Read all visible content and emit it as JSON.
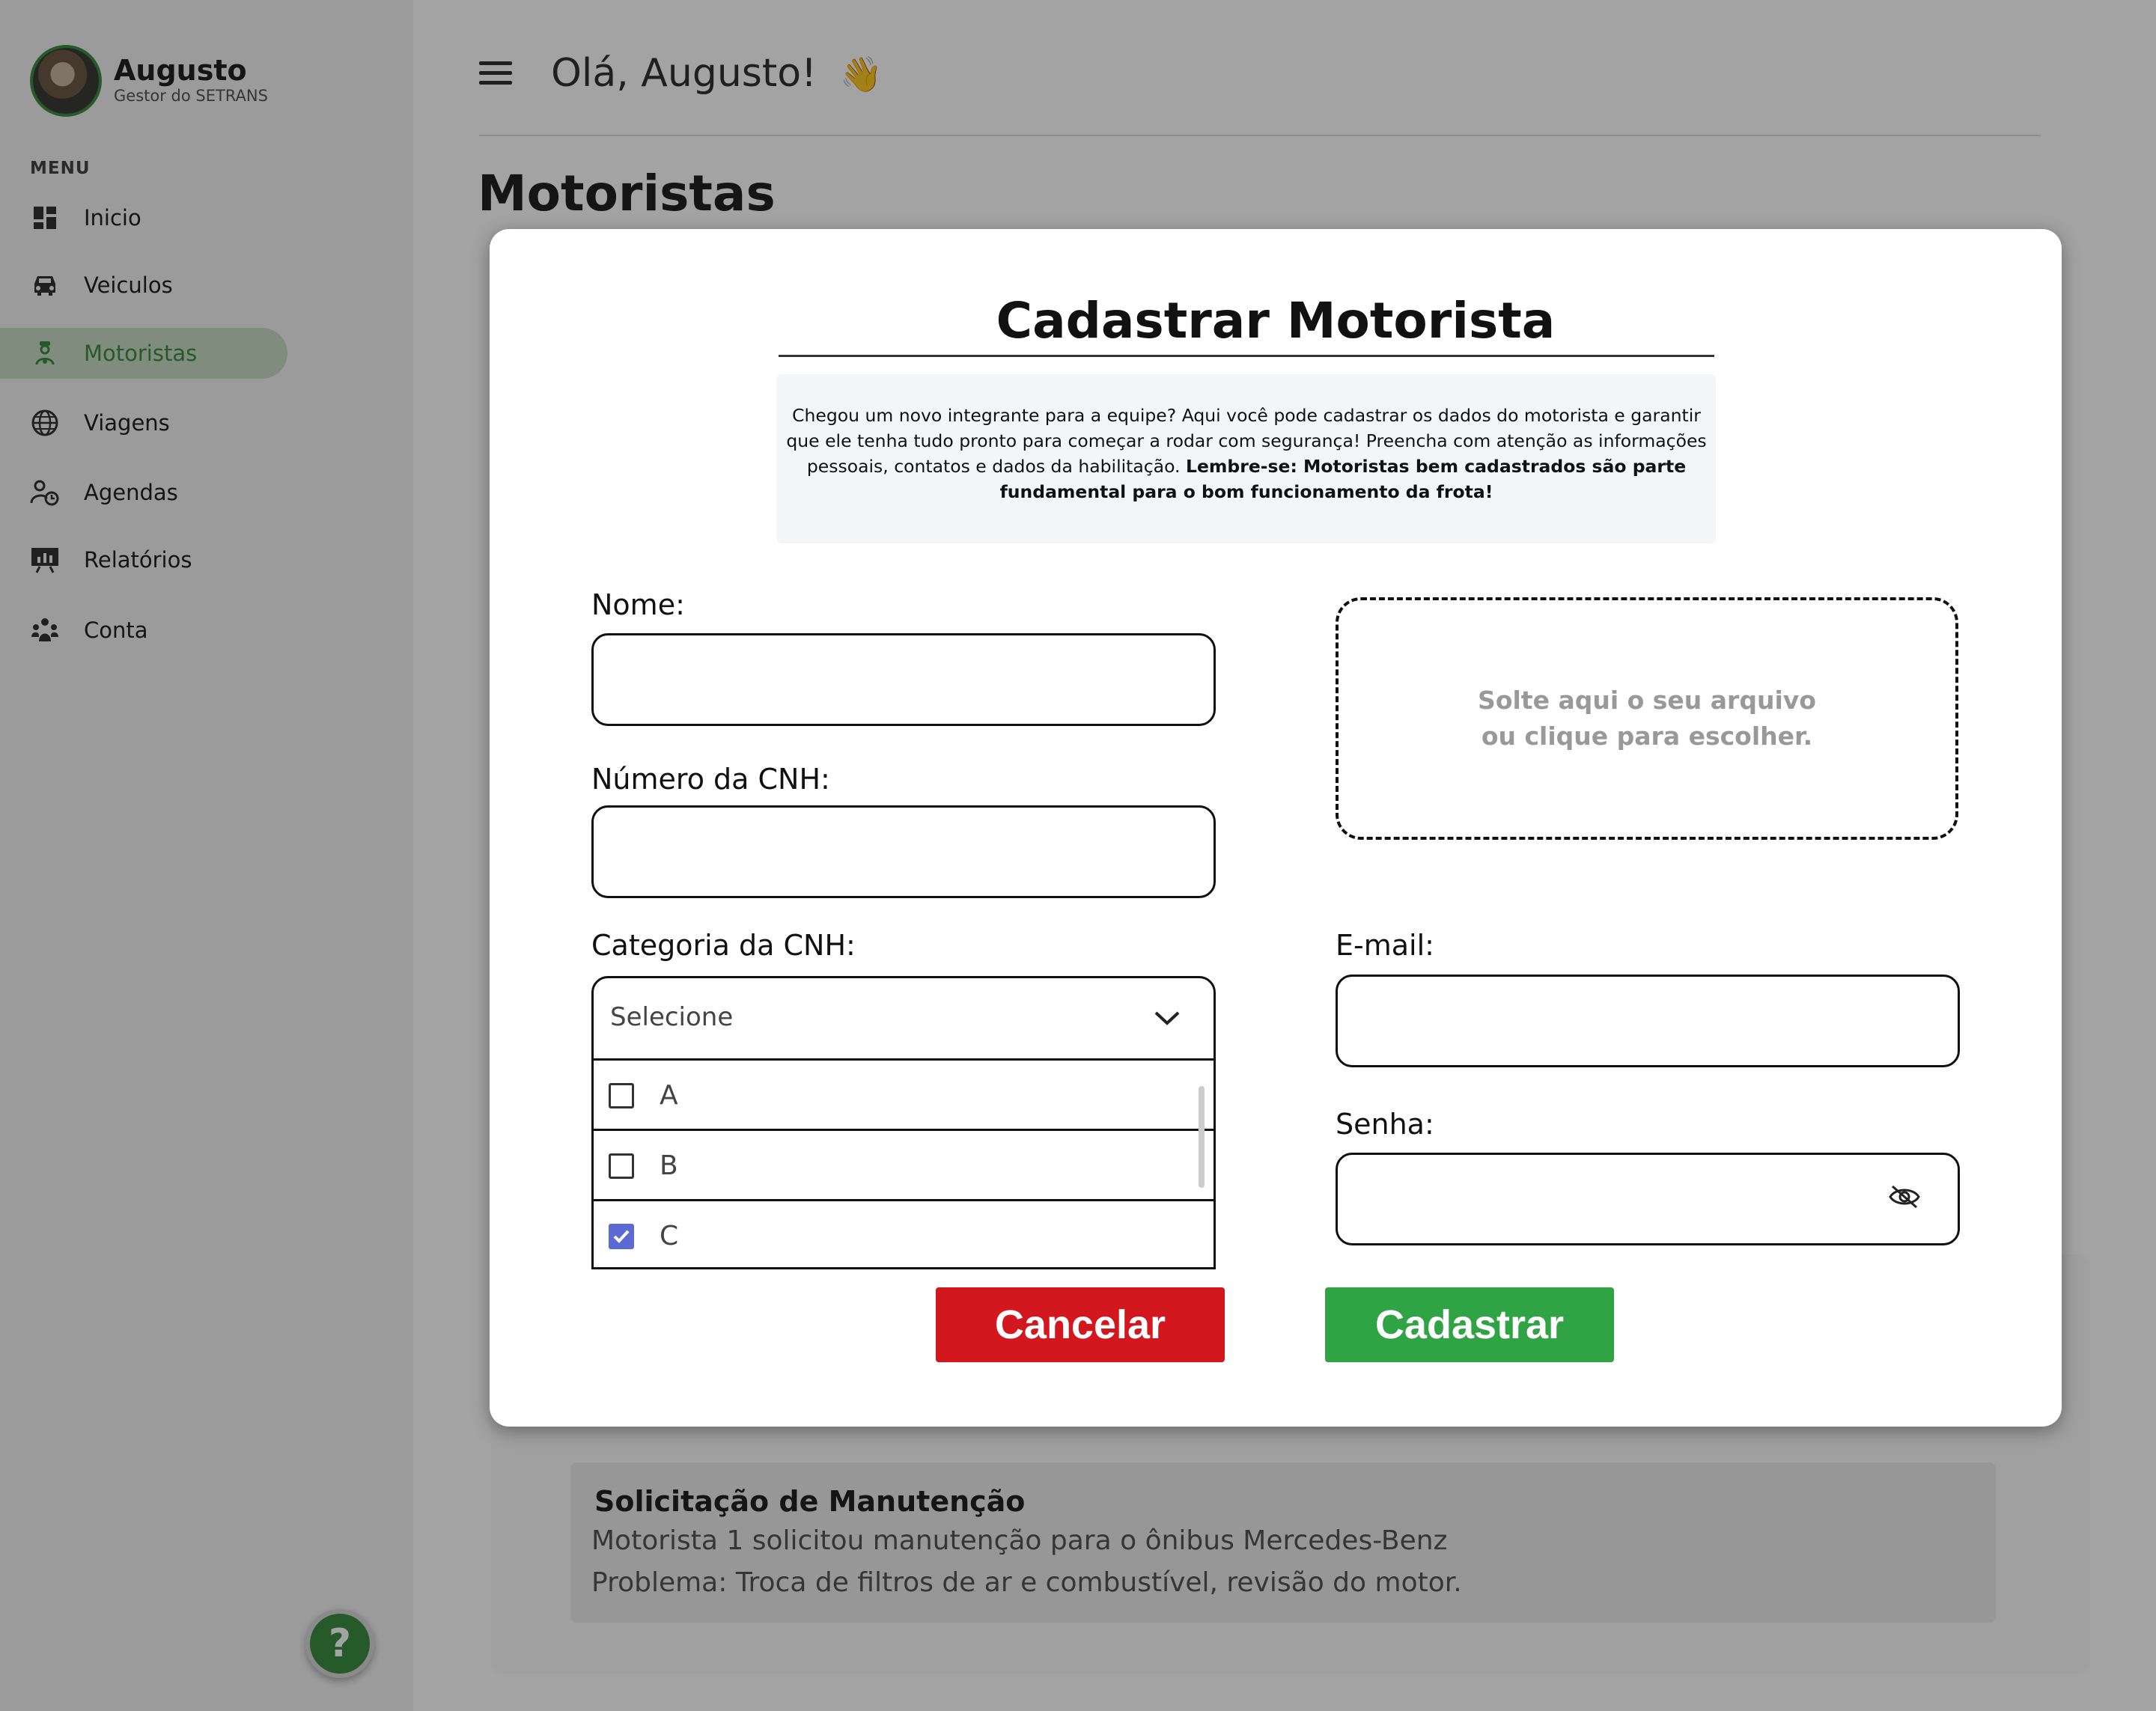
{
  "user": {
    "name": "Augusto",
    "role": "Gestor do SETRANS"
  },
  "menu": {
    "label": "MENU",
    "items": [
      {
        "label": "Inicio",
        "icon": "dashboard-icon",
        "active": false
      },
      {
        "label": "Veiculos",
        "icon": "car-icon",
        "active": false
      },
      {
        "label": "Motoristas",
        "icon": "driver-icon",
        "active": true
      },
      {
        "label": "Viagens",
        "icon": "globe-icon",
        "active": false
      },
      {
        "label": "Agendas",
        "icon": "schedule-icon",
        "active": false
      },
      {
        "label": "Relatórios",
        "icon": "report-icon",
        "active": false
      },
      {
        "label": "Conta",
        "icon": "people-icon",
        "active": false
      }
    ]
  },
  "header": {
    "greeting": "Olá, Augusto!",
    "emoji": "👋"
  },
  "page": {
    "title": "Motoristas"
  },
  "notice": {
    "title": "Solicitação de Manutenção",
    "line1": "Motorista 1 solicitou manutenção para o ônibus Mercedes-Benz",
    "line2": "Problema: Troca de filtros de ar e combustível, revisão do motor."
  },
  "modal": {
    "title": "Cadastrar Motorista",
    "intro": "Chegou um novo integrante para a equipe? Aqui você pode cadastrar os dados do motorista e garantir que ele tenha tudo pronto para começar a rodar com segurança! Preencha com atenção as informações pessoais, contatos e dados da habilitação.",
    "intro_bold": "Lembre-se: Motoristas bem cadastrados são parte fundamental para o bom funcionamento da frota!",
    "fields": {
      "name_label": "Nome:",
      "name_value": "",
      "cnh_number_label": "Número da CNH:",
      "cnh_number_value": "",
      "cnh_category_label": "Categoria da CNH:",
      "cnh_category_placeholder": "Selecione",
      "email_label": "E-mail:",
      "email_value": "",
      "password_label": "Senha:",
      "password_value": ""
    },
    "category_options": [
      {
        "label": "A",
        "checked": false
      },
      {
        "label": "B",
        "checked": false
      },
      {
        "label": "C",
        "checked": true
      }
    ],
    "dropzone_text": "Solte aqui o seu arquivo ou clique para escolher.",
    "cancel_label": "Cancelar",
    "submit_label": "Cadastrar"
  },
  "help": {
    "label": "?"
  },
  "colors": {
    "accent": "#3e8e43",
    "danger": "#d3171f",
    "success": "#30a444",
    "checkbox": "#5c6bd4"
  }
}
